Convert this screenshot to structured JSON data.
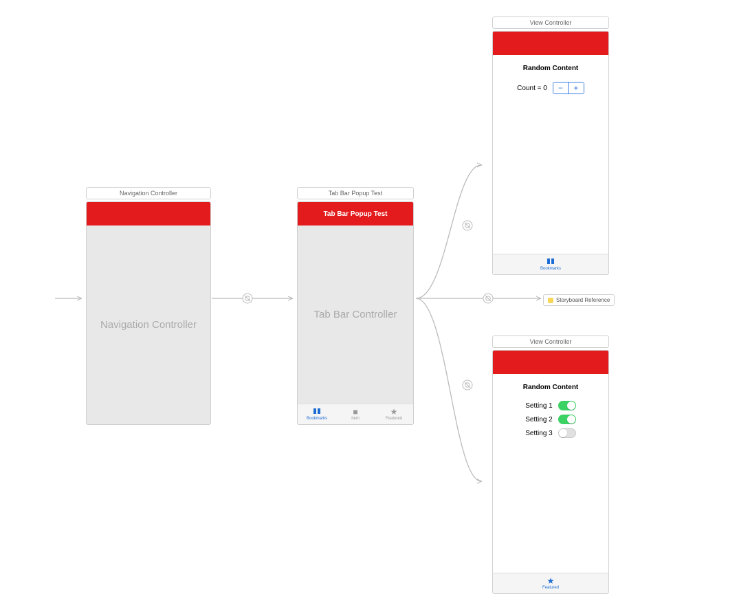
{
  "scenes": {
    "nav": {
      "title": "Navigation Controller",
      "content_label": "Navigation Controller"
    },
    "tabbar": {
      "title": "Tab Bar Popup Test",
      "nav_title": "Tab Bar Popup Test",
      "content_label": "Tab Bar Controller",
      "tabs": {
        "bookmarks": "Bookmarks",
        "item": "Item",
        "featured": "Featured"
      }
    },
    "vc1": {
      "title": "View Controller",
      "heading": "Random Content",
      "count_label": "Count = 0",
      "tab_label": "Bookmarks"
    },
    "vc2": {
      "title": "View Controller",
      "heading": "Random Content",
      "settings": {
        "s1": {
          "label": "Setting 1",
          "on": true
        },
        "s2": {
          "label": "Setting 2",
          "on": true
        },
        "s3": {
          "label": "Setting 3",
          "on": false
        }
      },
      "tab_label": "Featured"
    },
    "storyboard_ref": {
      "label": "Storyboard Reference"
    }
  }
}
